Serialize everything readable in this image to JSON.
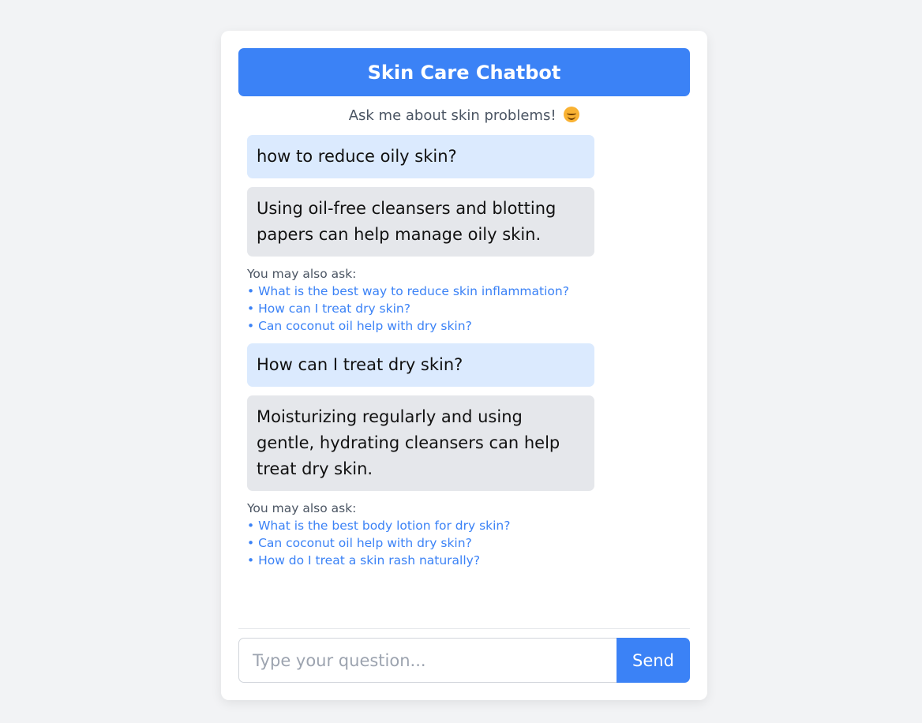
{
  "header": {
    "title": "Skin Care Chatbot"
  },
  "subtitle": {
    "text": "Ask me about skin problems!",
    "emoji_icon": "smiling-face-icon"
  },
  "conversation": [
    {
      "user": "how to reduce oily skin?",
      "bot": "Using oil-free cleansers and blotting papers can help manage oily skin.",
      "suggestions_label": "You may also ask:",
      "suggestions": [
        "• What is the best way to reduce skin inflammation?",
        "• How can I treat dry skin?",
        "• Can coconut oil help with dry skin?"
      ]
    },
    {
      "user": "How can I treat dry skin?",
      "bot": "Moisturizing regularly and using gentle, hydrating cleansers can help treat dry skin.",
      "suggestions_label": "You may also ask:",
      "suggestions": [
        "• What is the best body lotion for dry skin?",
        "• Can coconut oil help with dry skin?",
        "• How do I treat a skin rash naturally?"
      ]
    }
  ],
  "input": {
    "placeholder": "Type your question...",
    "value": ""
  },
  "send_button": {
    "label": "Send"
  },
  "colors": {
    "accent": "#3b82f6",
    "user_bubble": "#dbeafe",
    "bot_bubble": "#e5e7eb",
    "background": "#f2f3f5"
  }
}
